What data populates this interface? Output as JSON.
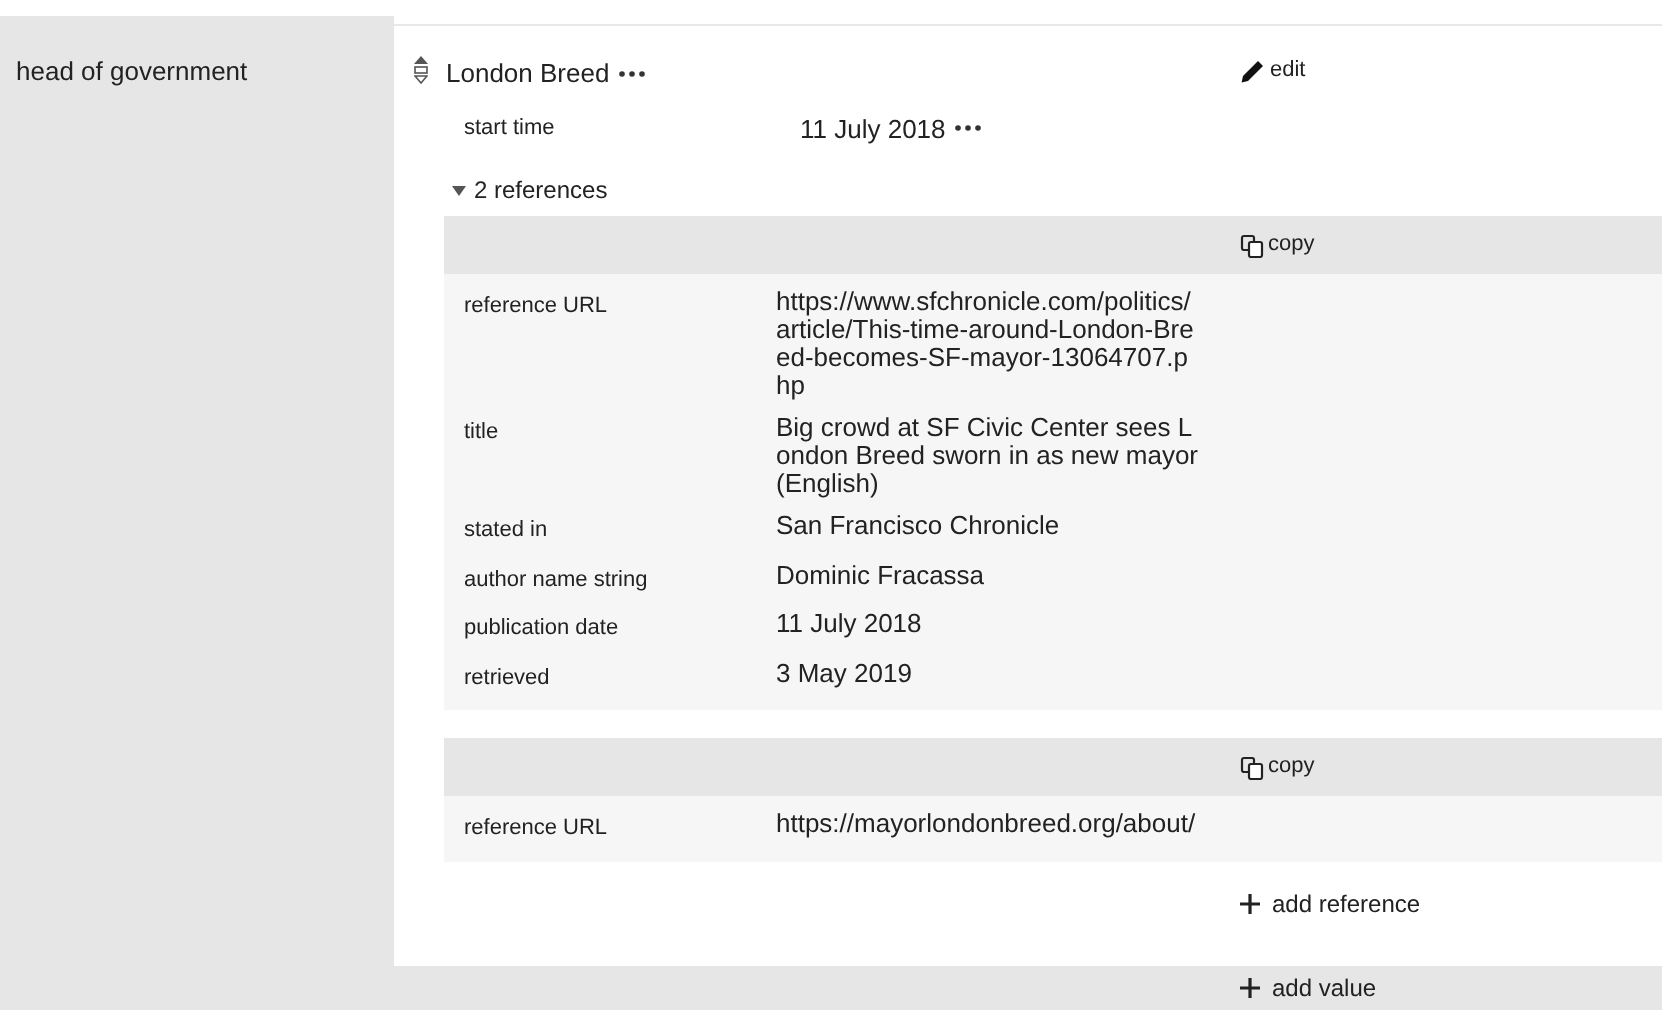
{
  "property": {
    "label": "head of government"
  },
  "statement": {
    "value": "London Breed",
    "edit": "edit",
    "qualifiers": [
      {
        "label": "start time",
        "value": "11 July 2018"
      }
    ],
    "references_toggle": {
      "label": "2 references",
      "expanded": true
    },
    "references": [
      {
        "copy": "copy",
        "rows": [
          {
            "label": "reference URL",
            "value": "https://www.sfchronicle.com/politics/article/This-time-around-London-Breed-becomes-SF-mayor-13064707.php"
          },
          {
            "label": "title",
            "value": "Big crowd at SF Civic Center sees London Breed sworn in as new mayor (English)"
          },
          {
            "label": "stated in",
            "value": "San Francisco Chronicle"
          },
          {
            "label": "author name string",
            "value": "Dominic Fracassa"
          },
          {
            "label": "publication date",
            "value": "11 July 2018"
          },
          {
            "label": "retrieved",
            "value": "3 May 2019"
          }
        ]
      },
      {
        "copy": "copy",
        "rows": [
          {
            "label": "reference URL",
            "value": "https://mayorlondonbreed.org/about/"
          }
        ]
      }
    ],
    "add_reference": "add reference"
  },
  "add_value": "add value"
}
